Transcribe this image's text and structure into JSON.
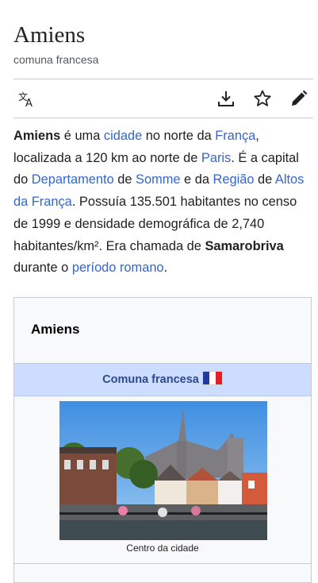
{
  "article": {
    "title": "Amiens",
    "subtitle": "comuna francesa"
  },
  "toolbar": {
    "icons": [
      "language-icon",
      "download-icon",
      "star-icon",
      "edit-pencil-icon"
    ]
  },
  "intro": {
    "t0": "Amiens",
    "t1": " é uma ",
    "l1": "cidade",
    "t2": " no norte da ",
    "l2": "França",
    "t3": ", localizada a 120 km ao norte de ",
    "l3": "Paris",
    "t4": ". É a capital do ",
    "l4": "Departamento",
    "t5": " de ",
    "l5": "Somme",
    "t6": " e da ",
    "l6": "Região",
    "t7": " de ",
    "l7": "Altos da França",
    "t8": ". Possuía 135.501 habitantes no censo de 1999 e densidade demográfica de 2,740 habitantes/km². Era chamada de ",
    "b1": "Samarobriva",
    "t9": " durante o ",
    "l8": "período romano",
    "t10": "."
  },
  "infobox": {
    "title": "Amiens",
    "band_label": "Comuna francesa",
    "flag_icon": "france-flag-icon",
    "image_caption": "Centro da cidade"
  },
  "colors": {
    "link": "#3366cc",
    "band": "#ccddff",
    "band_text": "#2a4b8d",
    "divider": "#c8ccd1"
  }
}
